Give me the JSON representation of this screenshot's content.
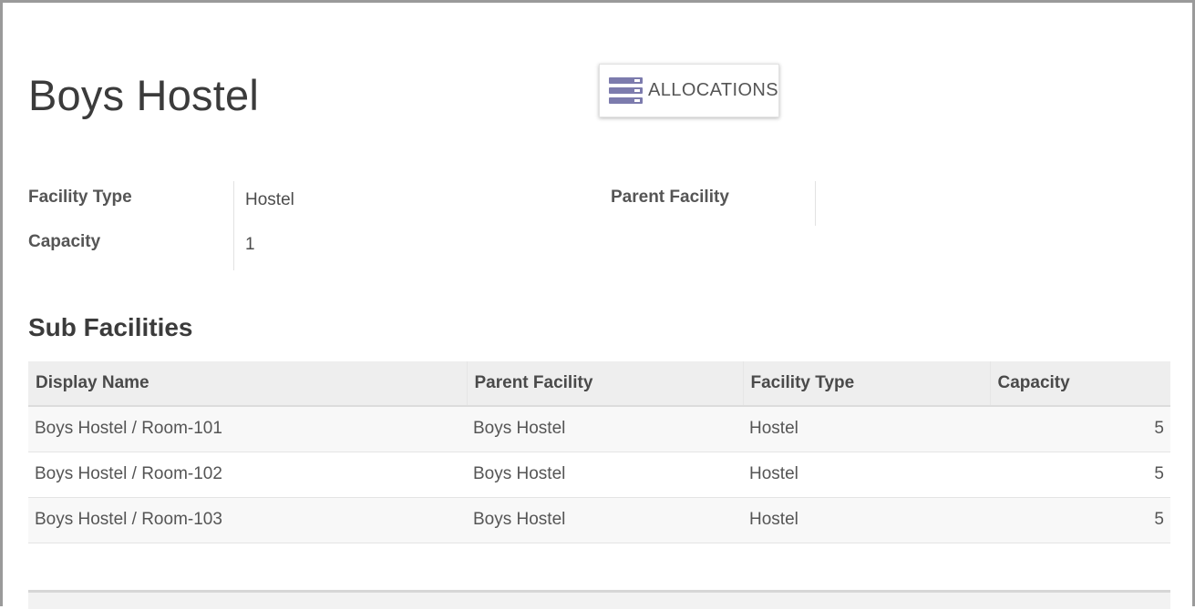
{
  "record": {
    "title": "Boys Hostel"
  },
  "smart_buttons": {
    "allocations_label": "ALLOCATIONS",
    "allocations_icon": "list-icon",
    "icon_color": "#7c7bad"
  },
  "fields": {
    "facility_type_label": "Facility Type",
    "facility_type_value": "Hostel",
    "capacity_label": "Capacity",
    "capacity_value": "1",
    "parent_facility_label": "Parent Facility",
    "parent_facility_value": ""
  },
  "sub_facilities": {
    "title": "Sub Facilities",
    "columns": [
      "Display Name",
      "Parent Facility",
      "Facility Type",
      "Capacity"
    ],
    "rows": [
      [
        "Boys Hostel / Room-101",
        "Boys Hostel",
        "Hostel",
        "5"
      ],
      [
        "Boys Hostel / Room-102",
        "Boys Hostel",
        "Hostel",
        "5"
      ],
      [
        "Boys Hostel / Room-103",
        "Boys Hostel",
        "Hostel",
        "5"
      ]
    ]
  }
}
